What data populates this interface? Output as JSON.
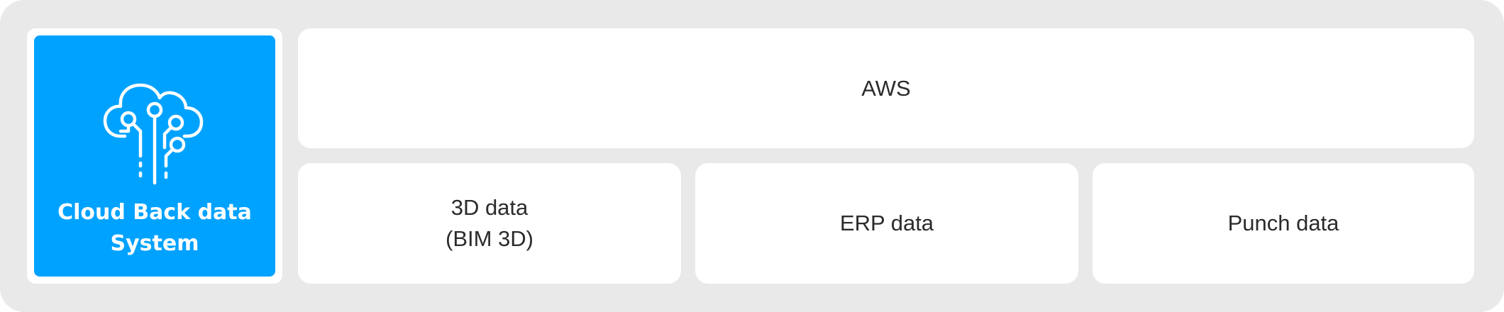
{
  "system_card": {
    "icon": "cloud-network-icon",
    "line1": "Cloud Back data",
    "line2": "System",
    "accent_color": "#00a2ff"
  },
  "boxes": {
    "aws": "AWS",
    "data_3d_line1": "3D data",
    "data_3d_line2": "(BIM 3D)",
    "erp": "ERP data",
    "punch": "Punch data"
  }
}
